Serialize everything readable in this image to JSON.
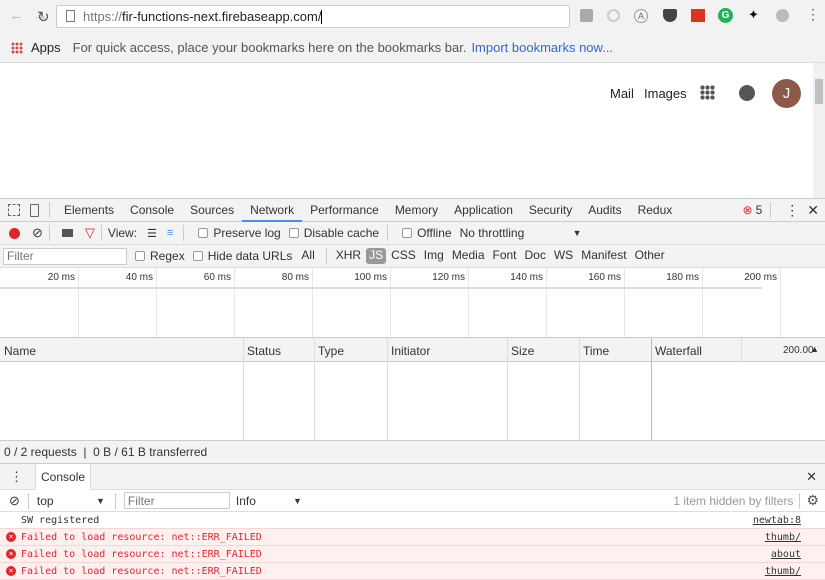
{
  "browser": {
    "url": "https://fir-functions-next.firebaseapp.com/",
    "url_scheme": "https://",
    "url_host": "fir-functions-next.firebaseapp.com/",
    "bookmarks": {
      "apps_label": "Apps",
      "hint": "For quick access, place your bookmarks here on the bookmarks bar.",
      "import_link": "Import bookmarks now..."
    }
  },
  "page": {
    "mail": "Mail",
    "images": "Images",
    "avatar_letter": "J",
    "avatar_color": "#8d5a4a"
  },
  "devtools": {
    "tabs": [
      "Elements",
      "Console",
      "Sources",
      "Network",
      "Performance",
      "Memory",
      "Application",
      "Security",
      "Audits",
      "Redux"
    ],
    "active_tab": "Network",
    "error_count": "5",
    "network": {
      "view_label": "View:",
      "preserve_log": "Preserve log",
      "disable_cache": "Disable cache",
      "offline": "Offline",
      "throttling": "No throttling",
      "filter_placeholder": "Filter",
      "regex": "Regex",
      "hide_data_urls": "Hide data URLs",
      "types": [
        "All",
        "XHR",
        "JS",
        "CSS",
        "Img",
        "Media",
        "Font",
        "Doc",
        "WS",
        "Manifest",
        "Other"
      ],
      "active_type": "JS",
      "ticks": [
        "20 ms",
        "40 ms",
        "60 ms",
        "80 ms",
        "100 ms",
        "120 ms",
        "140 ms",
        "160 ms",
        "180 ms",
        "200 ms"
      ],
      "columns": [
        "Name",
        "Status",
        "Type",
        "Initiator",
        "Size",
        "Time",
        "Waterfall"
      ],
      "waterfall_tick": "200.00",
      "summary": "0 / 2 requests  |  0 B / 61 B transferred"
    },
    "console": {
      "tab": "Console",
      "context": "top",
      "filter_placeholder": "Filter",
      "level": "Info",
      "hidden": "1 item hidden by filters",
      "messages": [
        {
          "text": "SW registered",
          "source": "newtab:8",
          "type": "log"
        },
        {
          "text": "Failed to load resource: net::ERR_FAILED",
          "source": "thumb/",
          "type": "error"
        },
        {
          "text": "Failed to load resource: net::ERR_FAILED",
          "source": "about",
          "type": "error"
        },
        {
          "text": "Failed to load resource: net::ERR_FAILED",
          "source": "thumb/",
          "type": "error"
        }
      ]
    }
  }
}
